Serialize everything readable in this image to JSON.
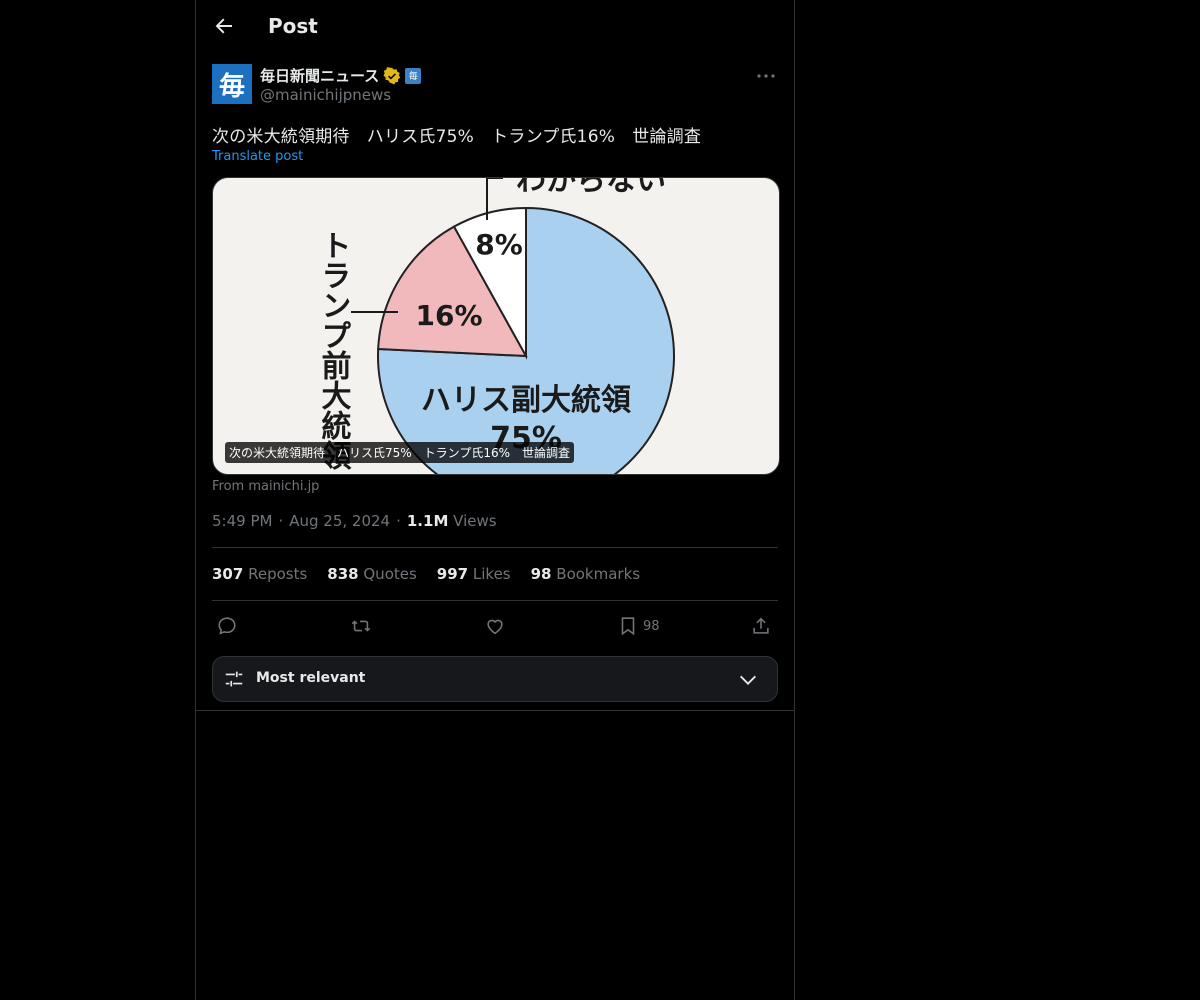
{
  "header": {
    "title": "Post"
  },
  "author": {
    "avatar_text": "毎",
    "name": "毎日新聞ニュース",
    "handle": "@mainichijpnews",
    "verified": "gold-check",
    "affiliation_badge": "毎"
  },
  "post": {
    "text": "次の米大統領期待　ハリス氏75%　トランプ氏16%　世論調査",
    "translate_label": "Translate post"
  },
  "media": {
    "chart_data": {
      "type": "pie",
      "labels": [
        "ハリス副大統領",
        "トランプ前大統領",
        "わからない"
      ],
      "values": [
        75,
        16,
        8
      ],
      "value_labels": [
        "75%",
        "16%",
        "8%"
      ],
      "colors": [
        "#a9d1ef",
        "#f2b9bd",
        "#ffffff"
      ]
    },
    "caption": "次の米大統領期待　ハリス氏75%　トランプ氏16%　世論調査",
    "source": "From mainichi.jp"
  },
  "meta": {
    "time": "5:49 PM",
    "date": "Aug 25, 2024",
    "views_count": "1.1M",
    "views_label": "Views",
    "sep": "·"
  },
  "stats": {
    "reposts": {
      "count": "307",
      "label": "Reposts"
    },
    "quotes": {
      "count": "838",
      "label": "Quotes"
    },
    "likes": {
      "count": "997",
      "label": "Likes"
    },
    "bookmarks": {
      "count": "98",
      "label": "Bookmarks"
    }
  },
  "actions": {
    "bookmark_count": "98"
  },
  "sort": {
    "label": "Most relevant"
  },
  "colors": {
    "accent": "#1d9bf0",
    "background": "#000000",
    "muted": "#71767b",
    "verified": "#e2b719"
  }
}
